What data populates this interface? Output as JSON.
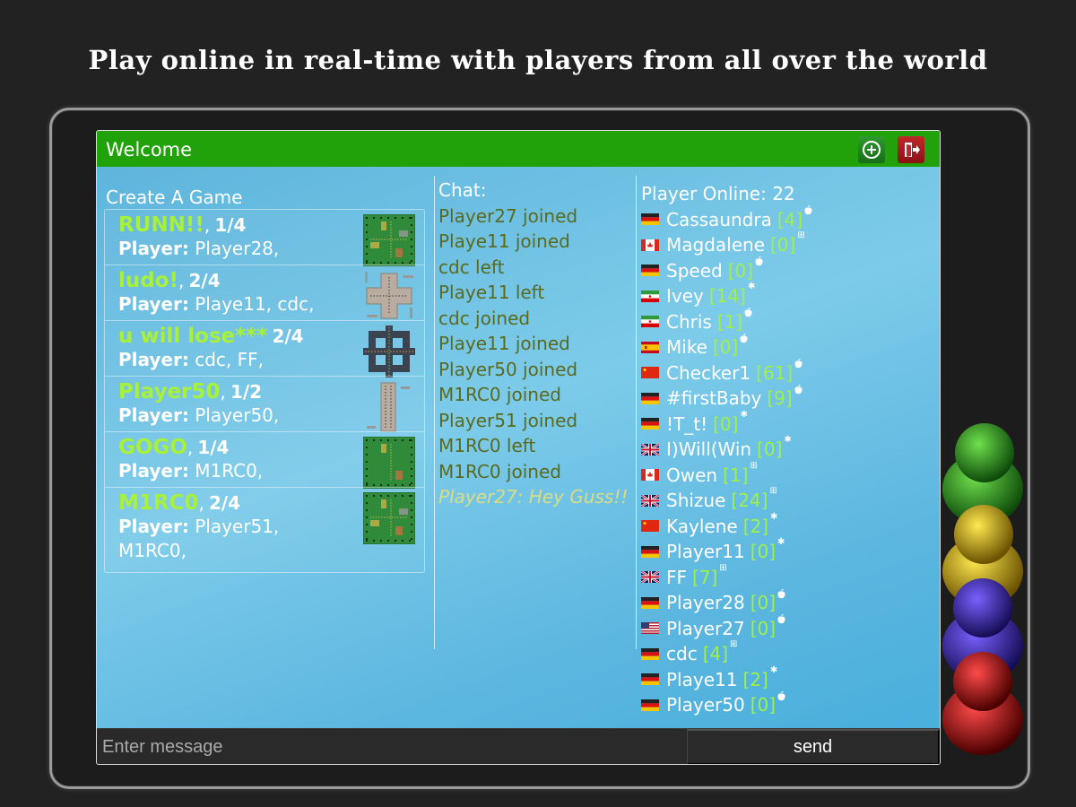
{
  "headline": "Play online in real-time with players from all over the world",
  "window": {
    "title": "Welcome",
    "add_button_icon": "plus-circle-icon",
    "exit_button_icon": "exit-door-icon"
  },
  "games": {
    "label": "Create A Game",
    "items": [
      {
        "name": "RUNN!!",
        "sep": ",",
        "count": "1/4",
        "player_label": "Player:",
        "players": "Player28,",
        "board": "green"
      },
      {
        "name": "ludo!",
        "sep": ",",
        "count": "2/4",
        "player_label": "Player:",
        "players": "Playe11, cdc,",
        "board": "cross"
      },
      {
        "name": "u will lose***",
        "sep": "",
        "count": "2/4",
        "player_label": "Player:",
        "players": "cdc, FF,",
        "board": "dark"
      },
      {
        "name": "Player50",
        "sep": ",",
        "count": "1/2",
        "player_label": "Player:",
        "players": "Player50,",
        "board": "strip"
      },
      {
        "name": "GOGO",
        "sep": ",",
        "count": "1/4",
        "player_label": "Player:",
        "players": "M1RC0,",
        "board": "green2"
      },
      {
        "name": "M1RC0",
        "sep": ",",
        "count": "2/4",
        "player_label": "Player:",
        "players": "Player51, M1RC0,",
        "board": "green"
      }
    ]
  },
  "chat": {
    "label": "Chat:",
    "messages": [
      {
        "text": "Player27 joined",
        "type": "system"
      },
      {
        "text": "Playe11 joined",
        "type": "system"
      },
      {
        "text": "cdc left",
        "type": "system"
      },
      {
        "text": "Playe11 left",
        "type": "system"
      },
      {
        "text": "cdc joined",
        "type": "system"
      },
      {
        "text": "Playe11 joined",
        "type": "system"
      },
      {
        "text": "Player50 joined",
        "type": "system"
      },
      {
        "text": "M1RC0 joined",
        "type": "system"
      },
      {
        "text": "Player51 joined",
        "type": "system"
      },
      {
        "text": "M1RC0 left",
        "type": "system"
      },
      {
        "text": "M1RC0 joined",
        "type": "system"
      },
      {
        "text": "Player27: Hey Guss!!",
        "type": "talk"
      }
    ]
  },
  "players": {
    "label": "Player Online: 22",
    "items": [
      {
        "name": "Cassaundra",
        "score": "[4]",
        "flag": "de",
        "os": "apple"
      },
      {
        "name": "Magdalene",
        "score": "[0]",
        "flag": "ca",
        "os": "windows"
      },
      {
        "name": "Speed",
        "score": "[0]",
        "flag": "de",
        "os": "apple"
      },
      {
        "name": "Ivey",
        "score": "[14]",
        "flag": "ir",
        "os": "android"
      },
      {
        "name": "Chris",
        "score": "[1]",
        "flag": "ir",
        "os": "apple"
      },
      {
        "name": "Mike",
        "score": "[0]",
        "flag": "es",
        "os": "apple"
      },
      {
        "name": "Checker1",
        "score": "[61]",
        "flag": "cn",
        "os": "apple"
      },
      {
        "name": "#firstBaby",
        "score": "[9]",
        "flag": "de",
        "os": "apple"
      },
      {
        "name": "!T_t!",
        "score": "[0]",
        "flag": "de",
        "os": "android"
      },
      {
        "name": "I)Will(Win",
        "score": "[0]",
        "flag": "gb",
        "os": "android"
      },
      {
        "name": "Owen",
        "score": "[1]",
        "flag": "ca",
        "os": "windows"
      },
      {
        "name": "Shizue",
        "score": "[24]",
        "flag": "gb",
        "os": "windows"
      },
      {
        "name": "Kaylene",
        "score": "[2]",
        "flag": "cn",
        "os": "android"
      },
      {
        "name": "Player11",
        "score": "[0]",
        "flag": "de",
        "os": "android"
      },
      {
        "name": "FF",
        "score": "[7]",
        "flag": "gb",
        "os": "windows"
      },
      {
        "name": "Player28",
        "score": "[0]",
        "flag": "de",
        "os": "apple"
      },
      {
        "name": "Player27",
        "score": "[0]",
        "flag": "us",
        "os": "apple"
      },
      {
        "name": "cdc",
        "score": "[4]",
        "flag": "de",
        "os": "windows"
      },
      {
        "name": "Playe11",
        "score": "[2]",
        "flag": "de",
        "os": "android"
      },
      {
        "name": "Player50",
        "score": "[0]",
        "flag": "de",
        "os": "apple"
      }
    ]
  },
  "input": {
    "placeholder": "Enter message",
    "value": "",
    "send_label": "send"
  },
  "colors": {
    "titlebar": "#22a20a",
    "game_name": "#a8f03a",
    "score": "#9ff04a",
    "chat_system": "#5a6a1e",
    "chat_talk": "#d9dc84"
  },
  "pawns": [
    "green",
    "yellow",
    "blue",
    "red"
  ]
}
